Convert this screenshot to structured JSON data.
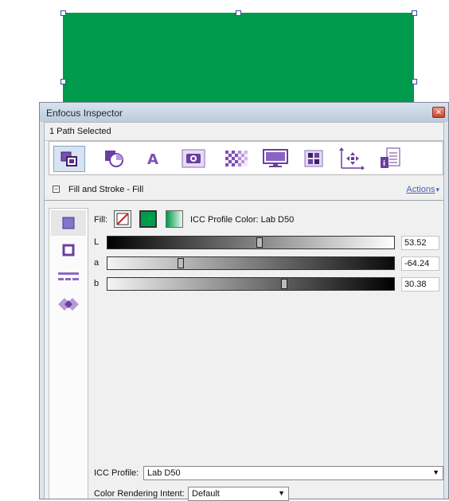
{
  "window": {
    "title": "Enfocus Inspector",
    "close_label": "✕"
  },
  "selection": {
    "text": "1 Path Selected"
  },
  "toolbar": {
    "buttons": [
      {
        "icon": "fill-stroke-icon"
      },
      {
        "icon": "shape-icon"
      },
      {
        "icon": "text-icon"
      },
      {
        "icon": "image-icon"
      },
      {
        "icon": "transparency-icon"
      },
      {
        "icon": "display-icon"
      },
      {
        "icon": "color-grid-icon"
      },
      {
        "icon": "position-icon"
      },
      {
        "icon": "document-icon"
      }
    ]
  },
  "section": {
    "collapse_symbol": "−",
    "title": "Fill and Stroke - Fill",
    "actions_label": "Actions",
    "actions_caret": "▾"
  },
  "side_tabs": [
    {
      "icon": "fill-square-icon"
    },
    {
      "icon": "stroke-square-icon"
    },
    {
      "icon": "dash-icon"
    },
    {
      "icon": "overprint-icon"
    }
  ],
  "fill": {
    "label": "Fill:",
    "icc_label": "ICC Profile Color: Lab D50",
    "color": "#009a4c"
  },
  "sliders": [
    {
      "label": "L",
      "value": "53.52",
      "position": 0.53
    },
    {
      "label": "a",
      "value": "-64.24",
      "position": 0.25
    },
    {
      "label": "b",
      "value": "30.38",
      "position": 0.62
    }
  ],
  "icc_profile": {
    "label": "ICC Profile:",
    "value": "Lab D50",
    "arrow": "▼"
  },
  "rendering_intent": {
    "label": "Color Rendering Intent:",
    "value": "Default",
    "arrow": "▼"
  },
  "colors": {
    "accent_purple": "#6b3fa0",
    "link": "#4d5fb6",
    "object_green": "#009a4c"
  }
}
